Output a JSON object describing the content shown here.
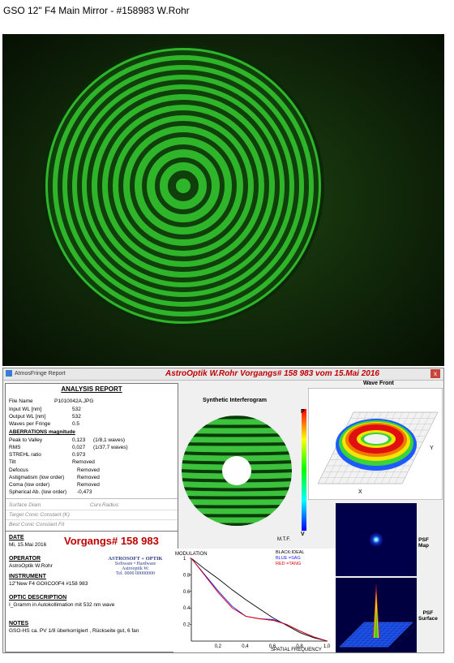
{
  "page_title": "GSO 12\" F4 Main Mirror - #158983 W.Rohr",
  "window": {
    "app_name": "AtmosFringe Report",
    "center_title": "AstroOptik W.Rohr   Vorgangs# 158 983 vom 15.Mai 2016",
    "close_label": "x"
  },
  "analysis": {
    "title": "ANALYSIS  REPORT",
    "file_label": "File Name",
    "file_value": "P1010042A.JPG",
    "input_wl_label": "Input WL [nm]",
    "input_wl_value": "532",
    "output_wl_label": "Output WL [nm]",
    "output_wl_value": "532",
    "waves_label": "Waves per Fringe",
    "waves_value": "0.5",
    "aberr_head": "ABERRATIONS magnitude",
    "ptv_label": "Peak to Valley",
    "ptv_value": "0,123",
    "ptv_waves": "(1/8,1 waves)",
    "rms_label": "RMS",
    "rms_value": "0,027",
    "rms_waves": "(1/37,7 waves)",
    "strehl_label": "STREHL ratio",
    "strehl_value": "0.973",
    "tilt_label": "Tilt",
    "tilt_value": "Removed",
    "defocus_label": "Defocus",
    "defocus_value": "Removed",
    "astig_label": "Astigmatism  (low order)",
    "astig_value": "Removed",
    "coma_label": "Coma         (low order)",
    "coma_value": "Removed",
    "sph_label": "Spherical Ab. (low order)",
    "sph_value": "-0,473",
    "surf_diam": "Surface Diam",
    "curv_radius": "Curv.Radius",
    "target_conic": "Target Conic Constant (K)",
    "best_conic": "Best Conic Constant Fit"
  },
  "info": {
    "date_head": "DATE",
    "date_value": "Mi, 15.Mai 2016",
    "vorgangs": "Vorgangs# 158 983",
    "operator_head": "OPERATOR",
    "operator_value": "AstroOptik W.Rohr",
    "instrument_head": "INSTRUMENT",
    "instrument_value": "12\"New F4 GOIICO0F4 #158 983",
    "optic_head": "OPTIC DESCRIPTION",
    "optic_value": "I_Gramm in Autokollimation mit 532 nm wave",
    "notes_head": "NOTES",
    "notes_value": "GSO-HS ca. PV 1/8 überkorrigiert , Rückseite gut, 6 fan",
    "stamp_line1": "ASTROSOFT + OPTIK",
    "stamp_line2": "Software • Hardware",
    "stamp_line3": "Astrooptik W.",
    "stamp_line4": "Tel. 0000 00000000"
  },
  "synthetic": {
    "label": "Synthetic Interferogram",
    "scale_top": "P",
    "scale_bottom": "V"
  },
  "wavefront": {
    "label": "Wave Front",
    "axis_y": "Y",
    "axis_x": "X"
  },
  "psf": {
    "map_label1": "PSF",
    "map_label2": "Map",
    "surface_label1": "PSF",
    "surface_label2": "Surface"
  },
  "chart_data": {
    "type": "line",
    "title": "M.T.F.",
    "ylabel": "MODULATION",
    "xlabel": "SPATIAL FREQUENCY",
    "xlim": [
      0,
      1.0
    ],
    "ylim": [
      0,
      1.0
    ],
    "x_ticks": [
      "0,2",
      "0,4",
      "0,6",
      "0,8",
      "1,0"
    ],
    "y_ticks": [
      "0.2",
      "0.4",
      "0.6",
      "0.8",
      "1"
    ],
    "legend": [
      {
        "label": "BLACK:IDEAL",
        "color": "#000000"
      },
      {
        "label": "BLUE  =SAG",
        "color": "#1a1aff"
      },
      {
        "label": "RED    =TANG",
        "color": "#e00000"
      }
    ],
    "x": [
      0,
      0.1,
      0.2,
      0.3,
      0.4,
      0.5,
      0.6,
      0.7,
      0.8,
      0.9,
      1.0
    ],
    "series": [
      {
        "name": "BLACK:IDEAL",
        "color": "#000000",
        "values": [
          1.0,
          0.87,
          0.75,
          0.62,
          0.5,
          0.39,
          0.28,
          0.19,
          0.1,
          0.04,
          0.0
        ]
      },
      {
        "name": "BLUE  =SAG",
        "color": "#1a1aff",
        "values": [
          1.0,
          0.8,
          0.6,
          0.42,
          0.3,
          0.27,
          0.26,
          0.2,
          0.12,
          0.05,
          0.0
        ]
      },
      {
        "name": "RED    =TANG",
        "color": "#e00000",
        "values": [
          1.0,
          0.79,
          0.58,
          0.4,
          0.3,
          0.27,
          0.25,
          0.2,
          0.12,
          0.05,
          0.0
        ]
      }
    ]
  }
}
